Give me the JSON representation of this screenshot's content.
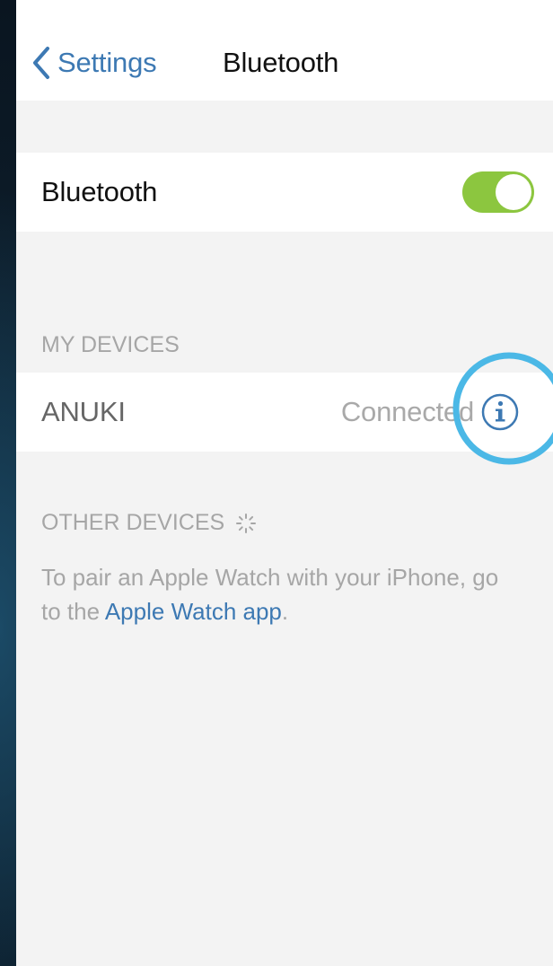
{
  "navbar": {
    "back_label": "Settings",
    "title": "Bluetooth"
  },
  "bluetooth": {
    "label": "Bluetooth",
    "enabled": true,
    "toggle_color": "#8cc63f"
  },
  "my_devices": {
    "header": "MY DEVICES",
    "devices": [
      {
        "name": "ANUKI",
        "status": "Connected",
        "icon": "info-icon"
      }
    ]
  },
  "other_devices": {
    "header": "OTHER DEVICES",
    "icon": "loading-spinner-icon",
    "pair_text_prefix": "To pair an Apple Watch with your iPhone, go to the ",
    "pair_link": "Apple Watch app",
    "pair_text_suffix": "."
  },
  "colors": {
    "accent": "#3d79b3",
    "highlight_ring": "#4bb8e6",
    "background": "#f3f3f3"
  }
}
